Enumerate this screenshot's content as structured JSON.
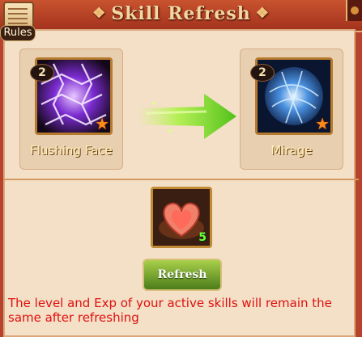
{
  "window": {
    "title": "Skill Refresh"
  },
  "rules": {
    "label": "Rules"
  },
  "from_skill": {
    "name": "Flushing Face",
    "level": "2"
  },
  "to_skill": {
    "name": "Mirage",
    "level": "2"
  },
  "item": {
    "count": "5"
  },
  "refresh_button": {
    "label": "Refresh"
  },
  "note": {
    "text": "The level and Exp of your active skills will remain the same after refreshing"
  },
  "colors": {
    "accent": "#b8432c",
    "note": "#e01010",
    "item_count": "#6bff3a",
    "star": "#ff8a1a"
  },
  "icons": {
    "rules": "scroll-icon",
    "arrow": "right-arrow-icon",
    "item": "heart-icon",
    "star": "star-icon"
  }
}
